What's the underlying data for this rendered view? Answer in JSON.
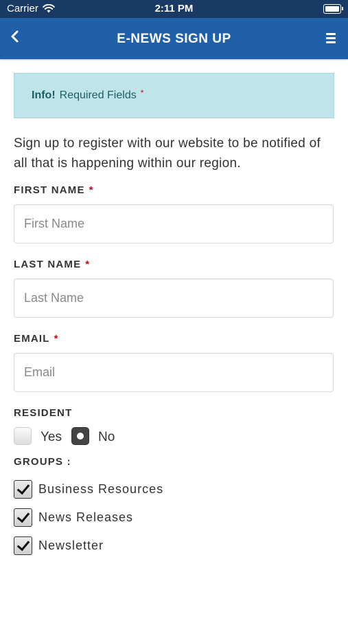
{
  "status_bar": {
    "carrier": "Carrier",
    "time": "2:11 PM"
  },
  "nav": {
    "title": "E-NEWS SIGN UP"
  },
  "info": {
    "strong": "Info!",
    "text": "Required Fields",
    "asterisk": "*"
  },
  "intro": "Sign up to register with our website to be notified of all that is happening within our region.",
  "fields": {
    "first_name": {
      "label": "FIRST NAME",
      "asterisk": "*",
      "placeholder": "First Name"
    },
    "last_name": {
      "label": "LAST NAME",
      "asterisk": "*",
      "placeholder": "Last Name"
    },
    "email": {
      "label": "EMAIL",
      "asterisk": "*",
      "placeholder": "Email"
    }
  },
  "resident": {
    "label": "RESIDENT",
    "options": [
      {
        "label": "Yes",
        "selected": false
      },
      {
        "label": "No",
        "selected": true
      }
    ]
  },
  "groups": {
    "label": "GROUPS :",
    "items": [
      {
        "label": "Business Resources",
        "checked": true
      },
      {
        "label": "News Releases",
        "checked": true
      },
      {
        "label": "Newsletter",
        "checked": true
      }
    ]
  },
  "colors": {
    "status_bar": "#1a3a66",
    "nav_bar": "#2060a8",
    "info_bg": "#bfe5ea",
    "required": "#d0021b"
  }
}
